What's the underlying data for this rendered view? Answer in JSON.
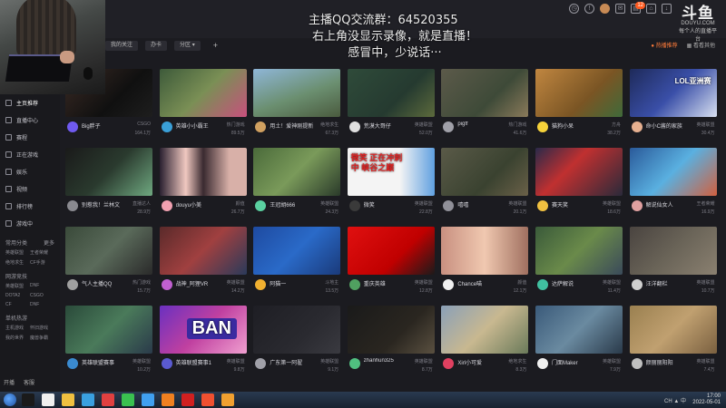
{
  "overlay": {
    "line1": "主播QQ交流群：64520355",
    "line2": "右上角没显示录像，就是直播！",
    "line3": "感冒中，少说话···"
  },
  "logo": {
    "name": "斗鱼",
    "domain": "DOUYU.COM",
    "tagline": "每个人的直播平台"
  },
  "topbar": {
    "notif_count": "12"
  },
  "filters": [
    "我的关注",
    "办卡",
    "分区 ▾",
    "+"
  ],
  "tools": {
    "hot": "● 热播推荐",
    "browse": "▦ 看看其他"
  },
  "sidebar": {
    "items": [
      "主页推荐",
      "直播中心",
      "赛程",
      "正在游戏",
      "娱乐",
      "视频",
      "排行榜",
      "游戏中"
    ],
    "sections": [
      {
        "title": "常用分类",
        "more": "更多",
        "items": [
          "英雄联盟",
          "王者荣耀",
          "绝地求生",
          "CF手游"
        ]
      },
      {
        "title": "网游竞技",
        "more": "",
        "items": [
          "英雄联盟",
          "DNF",
          "DOTA2",
          "CSGO",
          "CF",
          "DNF"
        ]
      },
      {
        "title": "单机热游",
        "more": "",
        "items": [
          "主机游戏",
          "怀旧游戏",
          "我的世界",
          "魔兽争霸"
        ]
      }
    ],
    "bottom": [
      "开播",
      "客服"
    ]
  },
  "cards": [
    {
      "name": "Big胖子",
      "cat": "CSGO",
      "sub": "",
      "heat": "164.1万",
      "bg": "linear-gradient(135deg,#3a2a24,#101010 60%,#1e1e1e)",
      "av": "#6f5af0",
      "text": ""
    },
    {
      "name": "英雄小小霸王",
      "cat": "热门游戏",
      "sub": "",
      "heat": "89.5万",
      "bg": "linear-gradient(135deg,#3d5a3a,#7a8f55 50%,#c7507d)",
      "av": "#3aa0d8",
      "text": ""
    },
    {
      "name": "用土！爱神刚提新",
      "cat": "绝地求生",
      "sub": "",
      "heat": "67.3万",
      "bg": "linear-gradient(160deg,#8fb6d8,#6b8f70 55%,#4a5a3e)",
      "av": "#d0a060",
      "text": ""
    },
    {
      "name": "荒漠大哥仔",
      "cat": "英雄联盟",
      "sub": "",
      "heat": "52.0万",
      "bg": "linear-gradient(135deg,#2f4b3a,#253a30 60%,#5c6a3c)",
      "av": "#e0e0e0",
      "text": ""
    },
    {
      "name": "pigff",
      "cat": "热门游戏",
      "sub": "",
      "heat": "41.6万",
      "bg": "linear-gradient(135deg,#5c5a4a,#3e4a38 60%,#8a7a5a)",
      "av": "#a0a0a8",
      "text": ""
    },
    {
      "name": "猫狗小呆",
      "cat": "方舟",
      "sub": "",
      "heat": "38.2万",
      "bg": "linear-gradient(135deg,#c08640,#7a5524 60%,#3f6a3a)",
      "av": "#f6d23a",
      "text": ""
    },
    {
      "name": "命小C酱的家族",
      "cat": "英雄联盟",
      "sub": "",
      "heat": "30.4万",
      "bg": "linear-gradient(135deg,#1e2a5a,#3a4fa8 50%,#d8e0f0)",
      "av": "#e6b090",
      "text": "LOL亚洲赛"
    },
    {
      "name": "别惹我！兰林文",
      "cat": "直播达人",
      "sub": "",
      "heat": "28.9万",
      "bg": "linear-gradient(135deg,#1a1a1a,#2a3a2e 50%,#6fa880)",
      "av": "#8a8a90",
      "text": ""
    },
    {
      "name": "douyu小美",
      "cat": "颜值",
      "sub": "",
      "heat": "26.7万",
      "bg": "linear-gradient(90deg,#2a2030,#f0c8c0 30%,#3a2a30 50%,#d8b0a8 80%)",
      "av": "#f0a0b0",
      "text": ""
    },
    {
      "name": "王冠胡666",
      "cat": "英雄联盟",
      "sub": "",
      "heat": "24.3万",
      "bg": "linear-gradient(135deg,#4a6a3a,#7a9a5a 50%,#2a3a2a)",
      "av": "#5ad0a0",
      "text": ""
    },
    {
      "name": "微笑",
      "cat": "英雄联盟",
      "sub": "",
      "heat": "22.8万",
      "bg": "linear-gradient(90deg,#f4f4f4 0%,#f4f4f4 60%,#60a0e0 100%)",
      "av": "#3a3a3a",
      "text": "微笑 正在冲刺中 峡谷之巅"
    },
    {
      "name": "嘻嘻",
      "cat": "英雄联盟",
      "sub": "",
      "heat": "20.1万",
      "bg": "linear-gradient(135deg,#5a5a48,#3a4230 60%,#6a6048)",
      "av": "#909098",
      "text": ""
    },
    {
      "name": "赛天笑",
      "cat": "英雄联盟",
      "sub": "",
      "heat": "18.6万",
      "bg": "linear-gradient(135deg,#2a2a4a,#c03030 40%,#2a2a3a)",
      "av": "#f0c040",
      "text": ""
    },
    {
      "name": "解说仙女人",
      "cat": "王者荣耀",
      "sub": "",
      "heat": "16.9万",
      "bg": "linear-gradient(135deg,#2a5a9a,#5ab0e0 50%,#d06040)",
      "av": "#e0a0a0",
      "text": ""
    },
    {
      "name": "气人主播QQ",
      "cat": "热门游戏",
      "sub": "",
      "heat": "15.7万",
      "bg": "linear-gradient(135deg,#3a4a3a,#5a6a5a 50%,#2a2a2a)",
      "av": "#a0a0a0",
      "text": ""
    },
    {
      "name": "战神_阿狸VR",
      "cat": "英雄联盟",
      "sub": "",
      "heat": "14.2万",
      "bg": "linear-gradient(135deg,#5a2a2a,#a04040 50%,#2a3a5a)",
      "av": "#c060d0",
      "text": ""
    },
    {
      "name": "阿猫一",
      "cat": "斗地主",
      "sub": "",
      "heat": "13.5万",
      "bg": "linear-gradient(135deg,#1e4aa0,#2a6ac8 50%,#1a3a7a)",
      "av": "#f0b030",
      "text": ""
    },
    {
      "name": "重庆英雄",
      "cat": "英雄联盟",
      "sub": "",
      "heat": "12.8万",
      "bg": "linear-gradient(135deg,#e01010,#c00000 60%,#1a1a1a)",
      "av": "#50a060",
      "text": ""
    },
    {
      "name": "Chance喵",
      "cat": "颜值",
      "sub": "",
      "heat": "12.1万",
      "bg": "linear-gradient(90deg,#c89080,#f0c8b0 50%,#a07060)",
      "av": "#f0f0f0",
      "text": ""
    },
    {
      "name": "达萨解说",
      "cat": "英雄联盟",
      "sub": "",
      "heat": "11.4万",
      "bg": "linear-gradient(135deg,#3a5a3a,#6a8a4a 50%,#3a4a5a)",
      "av": "#40c0a0",
      "text": ""
    },
    {
      "name": "汪洋翻栏",
      "cat": "英雄联盟",
      "sub": "",
      "heat": "10.7万",
      "bg": "linear-gradient(135deg,#4a4440,#6a6458 50%,#8a8070)",
      "av": "#d0d0d0",
      "text": ""
    },
    {
      "name": "英雄联盟赛事",
      "cat": "英雄联盟",
      "sub": "",
      "heat": "10.2万",
      "bg": "linear-gradient(135deg,#2a4a3a,#4a7a5a 50%,#2a3a4a)",
      "av": "#3a8ad0",
      "text": ""
    },
    {
      "name": "英雄联盟赛事1",
      "cat": "英雄联盟",
      "sub": "",
      "heat": "9.8万",
      "bg": "linear-gradient(135deg,#6a30c0,#c040a0 50%,#f0a0d0)",
      "av": "#5a5ad0",
      "text": "BAN"
    },
    {
      "name": "广东第一阿翟",
      "cat": "英雄联盟",
      "sub": "",
      "heat": "9.1万",
      "bg": "linear-gradient(135deg,#1e1e24,#2a2a30 60%,#3a3a40)",
      "av": "#a0a0a8",
      "text": ""
    },
    {
      "name": "zhanhun325",
      "cat": "英雄联盟",
      "sub": "",
      "heat": "8.7万",
      "bg": "linear-gradient(135deg,#1a1a1a,#2a2620 60%,#5a5040)",
      "av": "#50c080",
      "text": ""
    },
    {
      "name": "Xirl小可爱",
      "cat": "绝地求生",
      "sub": "",
      "heat": "8.3万",
      "bg": "linear-gradient(135deg,#8aa0b8,#c8b890 50%,#6a7a5a)",
      "av": "#e04060",
      "text": ""
    },
    {
      "name": "门面Maker",
      "cat": "英雄联盟",
      "sub": "",
      "heat": "7.9万",
      "bg": "linear-gradient(135deg,#3a5a7a,#6a8aa0 50%,#2a3a4a)",
      "av": "#f0f0f0",
      "text": ""
    },
    {
      "name": "颜丽丽阳阳",
      "cat": "英雄联盟",
      "sub": "",
      "heat": "7.4万",
      "bg": "linear-gradient(135deg,#9a8050,#c0a070 50%,#7a6040)",
      "av": "#c0c0c0",
      "text": ""
    }
  ],
  "taskbar": {
    "apps": [
      "#1a1a1a",
      "#f0f0f0",
      "#f0c040",
      "#3aa0e0",
      "#e04040",
      "#3ac050",
      "#40a0f0",
      "#f08020",
      "#d02020",
      "#f05030",
      "#f0a030"
    ],
    "time": "17:00",
    "date": "2022-05-01",
    "lang": "CH ▲ 中"
  }
}
